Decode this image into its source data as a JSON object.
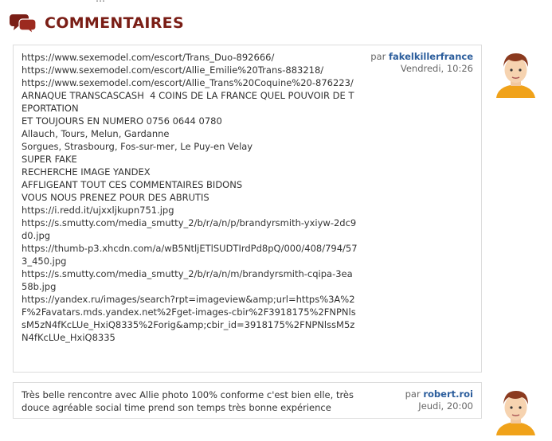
{
  "clipped_header": "…",
  "section": {
    "title": "COMMENTAIRES",
    "icon": "speech-bubbles-icon",
    "accent_color": "#7a1e16"
  },
  "comments": [
    {
      "by_prefix": "par",
      "author": "fakelkillerfrance",
      "date": "Vendredi, 10:26",
      "avatar": "user-avatar",
      "text": "https://www.sexemodel.com/escort/Trans_Duo-892666/\nhttps://www.sexemodel.com/escort/Allie_Emilie%20Trans-883218/\nhttps://www.sexemodel.com/escort/Allie_Trans%20Coquine%20-876223/\nARNAQUE TRANSCASCASH  4 COINS DE LA FRANCE QUEL POUVOIR DE TEPORTATION\nET TOUJOURS EN NUMERO 0756 0644 0780\nAllauch, Tours, Melun, Gardanne\nSorgues, Strasbourg, Fos-sur-mer, Le Puy-en Velay\nSUPER FAKE\nRECHERCHE IMAGE YANDEX\nAFFLIGEANT TOUT CES COMMENTAIRES BIDONS\nVOUS NOUS PRENEZ POUR DES ABRUTIS\nhttps://i.redd.it/ujxxljkupn751.jpg\nhttps://s.smutty.com/media_smutty_2/b/r/a/n/p/brandyrsmith-yxiyw-2dc9d0.jpg\nhttps://thumb-p3.xhcdn.com/a/wB5NtljETlSUDTIrdPd8pQ/000/408/794/573_450.jpg\nhttps://s.smutty.com/media_smutty_2/b/r/a/n/m/brandyrsmith-cqipa-3ea58b.jpg\nhttps://yandex.ru/images/search?rpt=imageview&amp;url=https%3A%2F%2Favatars.mds.yandex.net%2Fget-images-cbir%2F3918175%2FNPNlssM5zN4fKcLUe_HxiQ8335%2Forig&amp;cbir_id=3918175%2FNPNlssM5zN4fKcLUe_HxiQ8335"
    },
    {
      "by_prefix": "par",
      "author": "robert.roi",
      "date": "Jeudi, 20:00",
      "avatar": "user-avatar",
      "text": "Très belle rencontre avec Allie photo 100% conforme c'est bien elle, très douce agréable social time prend son temps très bonne expérience"
    }
  ]
}
